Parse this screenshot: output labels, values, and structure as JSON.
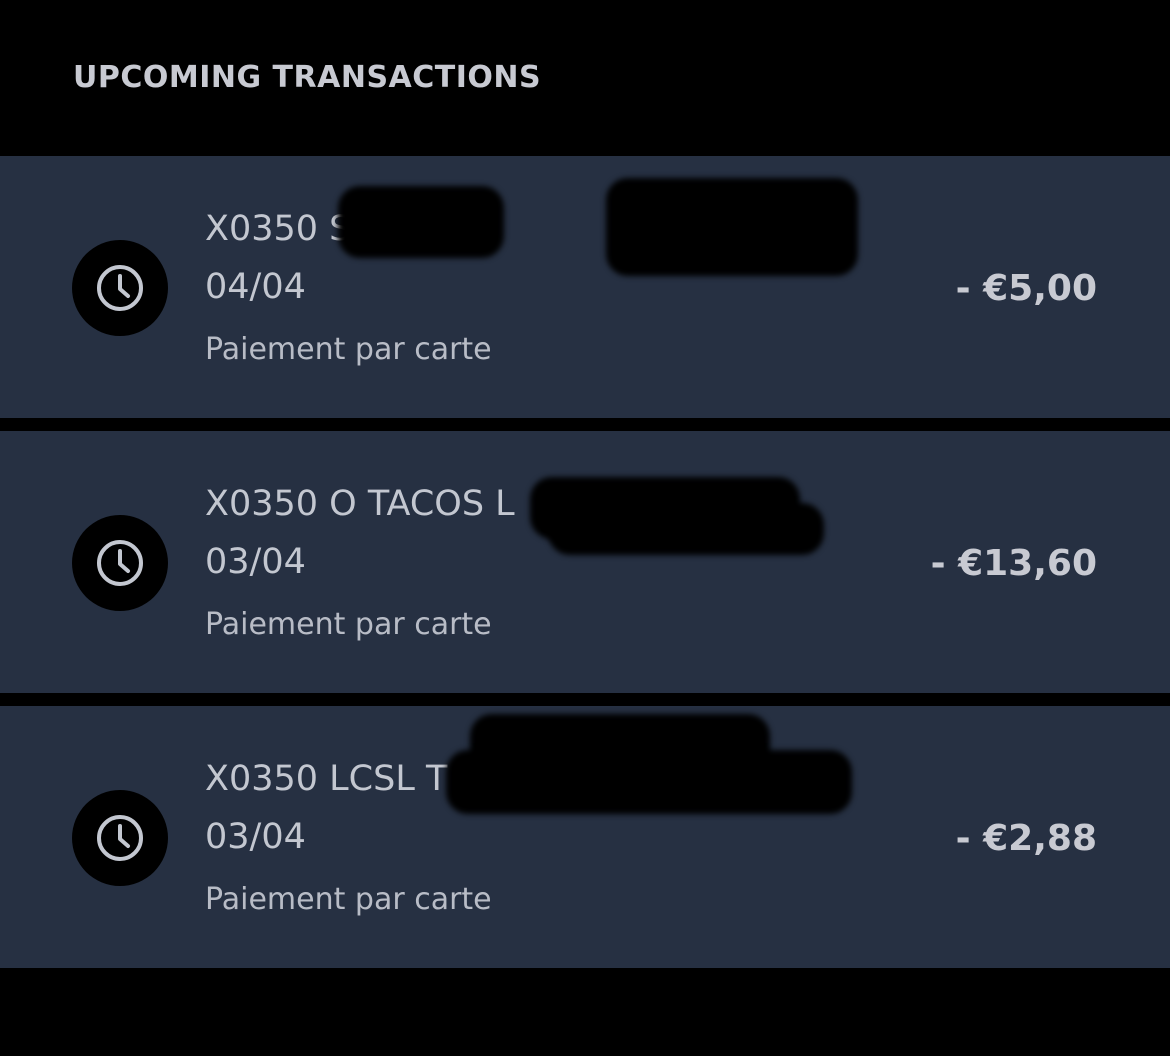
{
  "section": {
    "title": "UPCOMING TRANSACTIONS"
  },
  "transactions": [
    {
      "name": "X0350 S        CLUB",
      "date": "04/04",
      "type": "Paiement par carte",
      "amount": "- €5,00",
      "icon": "clock-icon"
    },
    {
      "name": "X0350 O TACOS L",
      "date": "03/04",
      "type": "Paiement par carte",
      "amount": "- €13,60",
      "icon": "clock-icon"
    },
    {
      "name": "X0350 LCSL T",
      "date": "03/04",
      "type": "Paiement par carte",
      "amount": "- €2,88",
      "icon": "clock-icon"
    }
  ],
  "colors": {
    "background": "#000000",
    "row_background": "#263042",
    "text_primary": "#c3c7d0",
    "text_secondary": "#b8bcc6"
  }
}
